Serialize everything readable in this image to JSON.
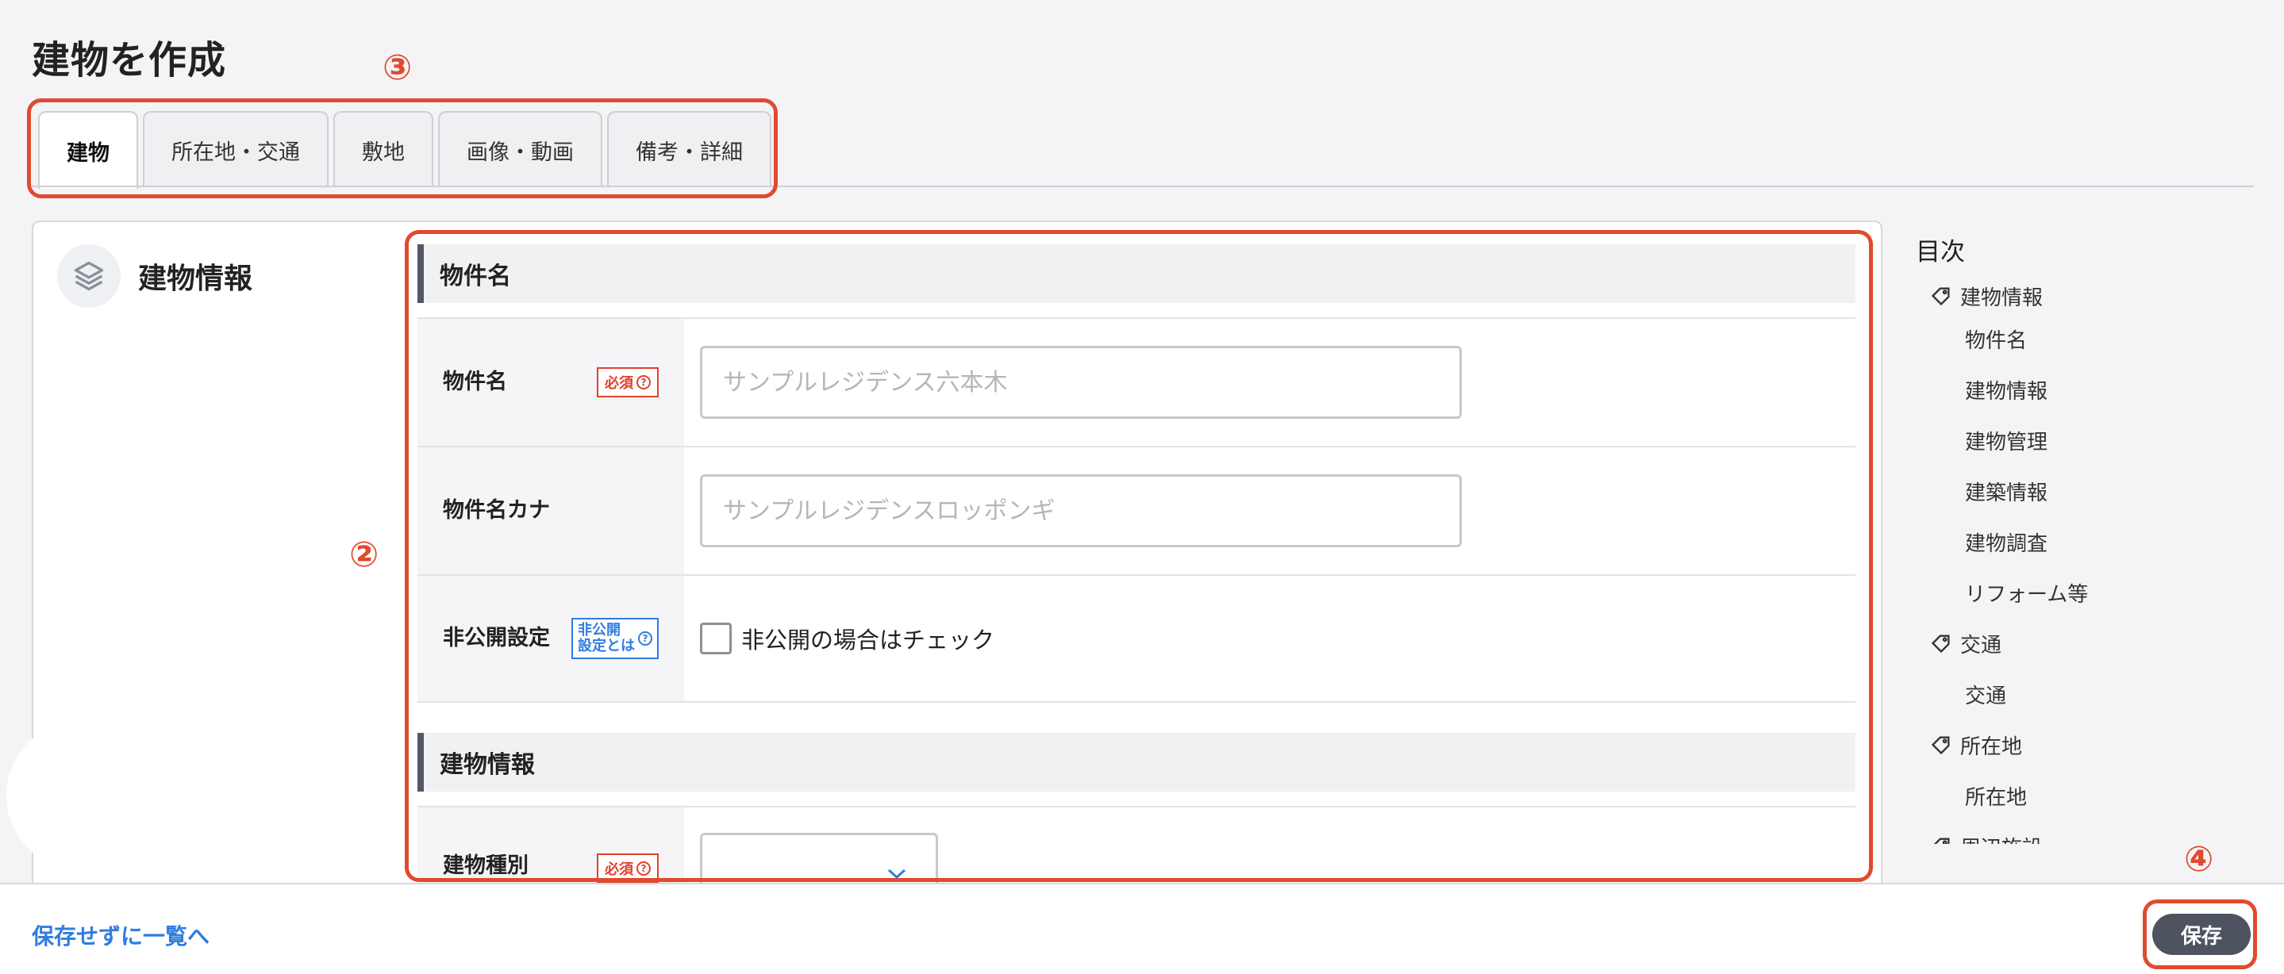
{
  "page": {
    "title": "建物を作成"
  },
  "tabs": [
    {
      "label": "建物"
    },
    {
      "label": "所在地・交通"
    },
    {
      "label": "敷地"
    },
    {
      "label": "画像・動画"
    },
    {
      "label": "備考・詳細"
    }
  ],
  "section": {
    "title": "建物情報"
  },
  "form": {
    "group1": {
      "title": "物件名"
    },
    "name": {
      "label": "物件名",
      "badge": "必須",
      "placeholder": "サンプルレジデンス六本木"
    },
    "kana": {
      "label": "物件名カナ",
      "placeholder": "サンプルレジデンスロッポンギ"
    },
    "private": {
      "label": "非公開設定",
      "badge_line1": "非公開",
      "badge_line2": "設定とは",
      "checkbox_label": "非公開の場合はチェック"
    },
    "group2": {
      "title": "建物情報"
    },
    "type": {
      "label": "建物種別",
      "badge": "必須"
    }
  },
  "toc": {
    "title": "目次",
    "items": [
      {
        "label": "建物情報",
        "level": 1
      },
      {
        "label": "物件名",
        "level": 2
      },
      {
        "label": "建物情報",
        "level": 2
      },
      {
        "label": "建物管理",
        "level": 2
      },
      {
        "label": "建築情報",
        "level": 2
      },
      {
        "label": "建物調査",
        "level": 2
      },
      {
        "label": "リフォーム等",
        "level": 2
      },
      {
        "label": "交通",
        "level": 1
      },
      {
        "label": "交通",
        "level": 2
      },
      {
        "label": "所在地",
        "level": 1
      },
      {
        "label": "所在地",
        "level": 2
      },
      {
        "label": "周辺施設",
        "level": 1
      }
    ]
  },
  "footer": {
    "back_label": "保存せずに一覧へ",
    "save_label": "保存"
  },
  "annotations": {
    "n2": "②",
    "n3": "③",
    "n4": "④"
  },
  "colors": {
    "accent": "#2f7de1",
    "required": "#e0402b",
    "annotation": "#e04a2f",
    "save_button": "#4e5360"
  }
}
